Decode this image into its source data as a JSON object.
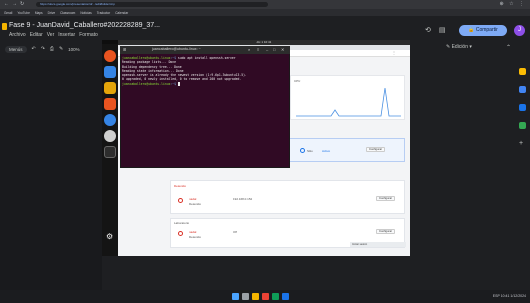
{
  "host_browser": {
    "address": "https://docs.google.com/presentation/d/.../edit#slide=id.p",
    "bookmarks": [
      "Gmail",
      "YouTube",
      "Maps",
      "Drive",
      "Classroom",
      "Noticias",
      "Traductor",
      "Calendar"
    ]
  },
  "slides_app": {
    "title": "Fase 9 - JuanDavid_Caballero#202228289_37...",
    "menus": [
      "Archivo",
      "Editar",
      "Ver",
      "Insertar",
      "Formato"
    ],
    "toolbar": {
      "menus_label": "Menús",
      "zoom": "100%"
    },
    "share_label": "Compartir",
    "avatar_initial": "J",
    "edit_label": "Edición"
  },
  "vm": {
    "top_bar_clock": "dic 1 10:41",
    "terminal": {
      "title": "juancaballero@ubuntu-linux: ~",
      "lines": [
        {
          "user": "juancaballero@ubuntu-linux",
          "path": ":~$ ",
          "cmd": "sudo apt install openssh-server"
        },
        {
          "text": "Reading package lists... Done"
        },
        {
          "text": "Building dependency tree... Done"
        },
        {
          "text": "Reading state information... Done"
        },
        {
          "text": "openssh-server is already the newest version (1:9.6p1-3ubuntu13.5)."
        },
        {
          "text": "0 upgraded, 0 newly installed, 0 to remove and 200 not upgraded."
        },
        {
          "user": "juancaballero@ubuntu-linux",
          "path": ":~$ ",
          "cmd": ""
        }
      ]
    },
    "web_panel": {
      "graph_label": "CPU",
      "rows": [
        {
          "name": "Sitio",
          "status": "Activo",
          "status_color": "#1a73e8",
          "action": "Configurar"
        },
        {
          "name": "nadal",
          "sub": "Detenido",
          "ip": "192.168.0.152",
          "status_color": "#d93025",
          "action": "Configurar"
        },
        {
          "name": "nadal",
          "sub": "Detenido",
          "ip": "Off",
          "status_color": "#d93025",
          "action": "Configurar"
        }
      ],
      "section_red": "Detenido",
      "section_gray": "Laboratorio",
      "footer": "Iniciar sesión"
    }
  },
  "taskbar": {
    "tray": "ESP  10:41  1/12/2024"
  },
  "colors": {
    "accent": "#7eaaf5",
    "terminal_bg": "#300a24",
    "avatar": "#8e4fe8"
  }
}
